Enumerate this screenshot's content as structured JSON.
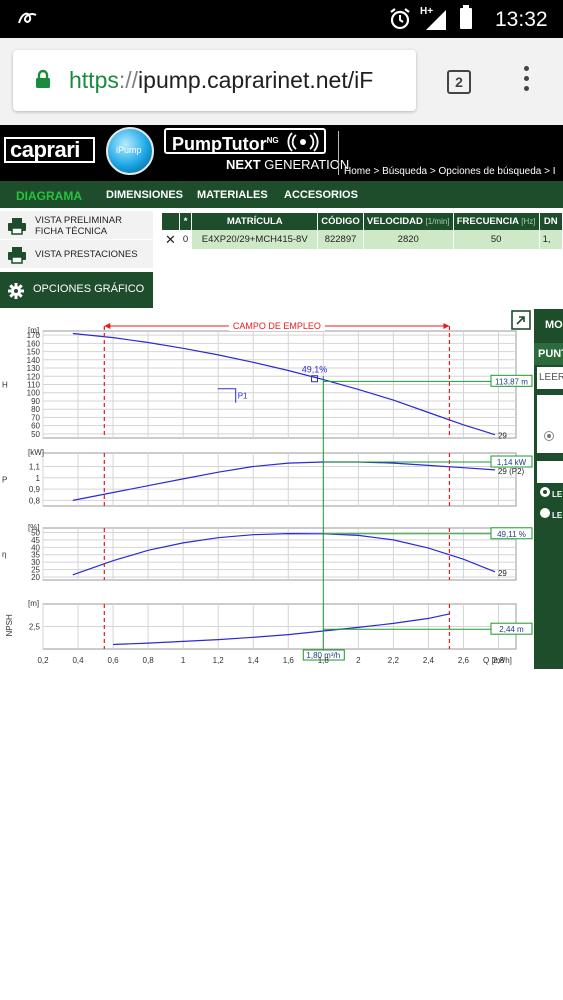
{
  "status_bar": {
    "time": "13:32",
    "network": "H+"
  },
  "browser": {
    "url_scheme": "https",
    "url_sep": "://",
    "url_rest": "ipump.caprarinet.net/iF",
    "tab_count": "2"
  },
  "header": {
    "brand": "caprari",
    "pump_badge": "iPump",
    "product": "PumpTutor",
    "product_sup": "NG",
    "subtitle_bold": "NEXT",
    "subtitle": " GENERATION",
    "breadcrumb": "Home > Búsqueda > Opciones de búsqueda > I"
  },
  "tabs": [
    "DIAGRAMA",
    "DIMENSIONES",
    "MATERIALES",
    "ACCESORIOS"
  ],
  "left_menu": {
    "item1_line1": "VISTA PRELIMINAR",
    "item1_line2": "FICHA TÉCNICA",
    "item2": "VISTA PRESTACIONES",
    "item3": "OPCIONES GRÁFICO"
  },
  "table": {
    "headers": [
      "",
      "*",
      "MATRÍCULA",
      "CÓDIGO",
      "VELOCIDAD",
      "FRECUENCIA",
      "DN"
    ],
    "units": {
      "velocidad": "[1/min]",
      "frecuencia": "[Hz]"
    },
    "row": {
      "close": "✕",
      "star": "0",
      "matricula": "E4XP20/29+MCH415-8V",
      "codigo": "822897",
      "velocidad": "2820",
      "frecuencia": "50",
      "dn": "1,"
    }
  },
  "right_panel": {
    "title": "MO",
    "punt": "PUNT",
    "input": "LEER",
    "le1": "LE",
    "le2": "LE"
  },
  "chart_data": {
    "type": "line",
    "x_label": "Q [m³/h]",
    "x_ticks": [
      "0,2",
      "0,4",
      "0,6",
      "0,8",
      "1",
      "1,2",
      "1,4",
      "1,6",
      "1,8",
      "2",
      "2,2",
      "2,4",
      "2,6",
      "2,8"
    ],
    "xlim": [
      0.2,
      2.9
    ],
    "range_label": "CAMPO DE EMPLEO",
    "range": [
      0.55,
      2.52
    ],
    "operating_point_q": 1.8,
    "operating_point_label": "1,80 m³/h",
    "panels": [
      {
        "name": "H",
        "unit": "[m]",
        "ylim": [
          45,
          175
        ],
        "ticks": [
          50,
          60,
          70,
          80,
          90,
          100,
          110,
          120,
          130,
          140,
          150,
          160,
          170
        ],
        "series_label": "29",
        "x": [
          0.37,
          0.6,
          0.8,
          1.0,
          1.2,
          1.4,
          1.6,
          1.8,
          2.0,
          2.2,
          2.4,
          2.6,
          2.78
        ],
        "y": [
          172,
          167,
          161,
          154,
          146,
          137,
          127,
          116,
          104,
          91,
          76,
          61,
          49
        ],
        "readout": "113,87 m",
        "readout_value": 113.87,
        "point_label": "49,1%",
        "point_q": 1.75,
        "point_y": 117,
        "p1_label": "P1",
        "p1_q": 1.3,
        "p1_y": 100
      },
      {
        "name": "P",
        "unit": "[kW]",
        "ylim": [
          0.75,
          1.22
        ],
        "ticks": [
          "0,8",
          "0,9",
          "1",
          "1,1"
        ],
        "tick_values": [
          0.8,
          0.9,
          1.0,
          1.1
        ],
        "series_label": "29 (P2)",
        "x": [
          0.37,
          0.6,
          0.8,
          1.0,
          1.2,
          1.4,
          1.6,
          1.8,
          2.0,
          2.2,
          2.4,
          2.6,
          2.78
        ],
        "y": [
          0.8,
          0.87,
          0.93,
          0.99,
          1.05,
          1.1,
          1.13,
          1.14,
          1.14,
          1.13,
          1.11,
          1.09,
          1.07
        ],
        "readout": "1,14 kW",
        "readout_value": 1.14
      },
      {
        "name": "η",
        "unit": "[%]",
        "ylim": [
          18,
          53
        ],
        "ticks": [
          20,
          25,
          30,
          35,
          40,
          45,
          50
        ],
        "series_label": "29",
        "x": [
          0.37,
          0.6,
          0.8,
          1.0,
          1.2,
          1.4,
          1.6,
          1.8,
          2.0,
          2.2,
          2.4,
          2.6,
          2.78
        ],
        "y": [
          21.5,
          31,
          38,
          43,
          46.5,
          48.5,
          49.2,
          49.1,
          48,
          45,
          39.5,
          32,
          23.5
        ],
        "readout": "49,11 %",
        "readout_value": 49.11
      },
      {
        "name": "NPSH",
        "unit": "[m]",
        "ylim": [
          2.0,
          3.0
        ],
        "ticks": [
          "2,5"
        ],
        "tick_values": [
          2.5
        ],
        "x": [
          0.6,
          0.8,
          1.0,
          1.2,
          1.4,
          1.6,
          1.8,
          2.0,
          2.2,
          2.4,
          2.52
        ],
        "y": [
          2.1,
          2.13,
          2.17,
          2.21,
          2.26,
          2.32,
          2.4,
          2.48,
          2.57,
          2.68,
          2.78
        ],
        "readout": "2,44 m",
        "readout_value": 2.44
      }
    ]
  }
}
